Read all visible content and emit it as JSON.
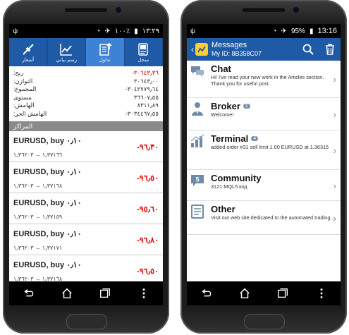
{
  "left_phone": {
    "status": {
      "battery": "١٠٠٪",
      "time": "١٣:٢٩"
    },
    "tabs": [
      {
        "label": "أسعار",
        "icon": "quotes-icon"
      },
      {
        "label": "رسم بياني",
        "icon": "chart-icon"
      },
      {
        "label": "تداول",
        "icon": "trade-icon",
        "active": true
      },
      {
        "label": "سجل",
        "icon": "history-icon"
      }
    ],
    "summary": [
      {
        "label": "ربح:",
        "value": "-٣٠٦٤٣٫٣٦",
        "red": true
      },
      {
        "label": "التوازن:",
        "value": "٣٠٦٤٣٫٠٠"
      },
      {
        "label": "المجموع:",
        "value": "-٣٠٤٢٧٧٩٫٦٤"
      },
      {
        "label": "مستوى",
        "value": "٣٦٦٠٧٫٥٥"
      },
      {
        "label": "الهامش:",
        "value": "٨٣١١٫٨٩"
      },
      {
        "label": "الهامش الحر:",
        "value": "-٣٠٣٤٤٦٧٫٥٥"
      }
    ],
    "section_title": "المراكز",
    "positions": [
      {
        "name": "EURUSD, buy ٠٫١٠",
        "price": "١٫٣٧١٦٦ → ١٫٣٦٢٠٣",
        "profit": "-٩٦٫٣٠"
      },
      {
        "name": "EURUSD, buy ٠٫١٠",
        "price": "١٫٣٧١٦٨ → ١٫٣٦٢٠٣",
        "profit": "-٩٦٫٥٠"
      },
      {
        "name": "EURUSD, buy ٠٫١٠",
        "price": "١٫٣٧١٥٩ → ١٫٣٦٢٠٣",
        "profit": "-٩٥٫٦٠"
      },
      {
        "name": "EURUSD, buy ٠٫١٠",
        "price": "١٫٣٧١٧١ → ١٫٣٦٢٠٣",
        "profit": "-٩٦٫٨٠"
      },
      {
        "name": "EURUSD, buy ٠٫١٠",
        "price": "١٫٣٧١٦٨ → ١٫٣٦٢٠٣",
        "profit": "-٩٦٫٥٠"
      }
    ]
  },
  "right_phone": {
    "status": {
      "battery": "95%",
      "time": "13:16"
    },
    "header": {
      "title": "Messages",
      "subtitle": "My ID: 8B358C07"
    },
    "messages": [
      {
        "title": "Chat",
        "badge": "",
        "text": "Hi! I've read your new work in the Articles section. Thank you for useful post.",
        "icon": "chat-icon"
      },
      {
        "title": "Broker",
        "badge": "1",
        "text": "Welcome!",
        "icon": "broker-icon"
      },
      {
        "title": "Terminal",
        "badge": "4",
        "text": "added order #31 sell limit 1.00 EURUSD at 1.36316",
        "icon": "terminal-icon"
      },
      {
        "title": "Community",
        "badge": "",
        "text": "3121 MQL5 код",
        "icon": "community-icon"
      },
      {
        "title": "Other",
        "badge": "",
        "text": "Visit out web site dedicated to the automated trading...",
        "icon": "other-icon"
      }
    ]
  },
  "colors": {
    "header_blue": "#1f5aa6",
    "active_tab": "#3d82d4",
    "loss_red": "#dd0000"
  }
}
